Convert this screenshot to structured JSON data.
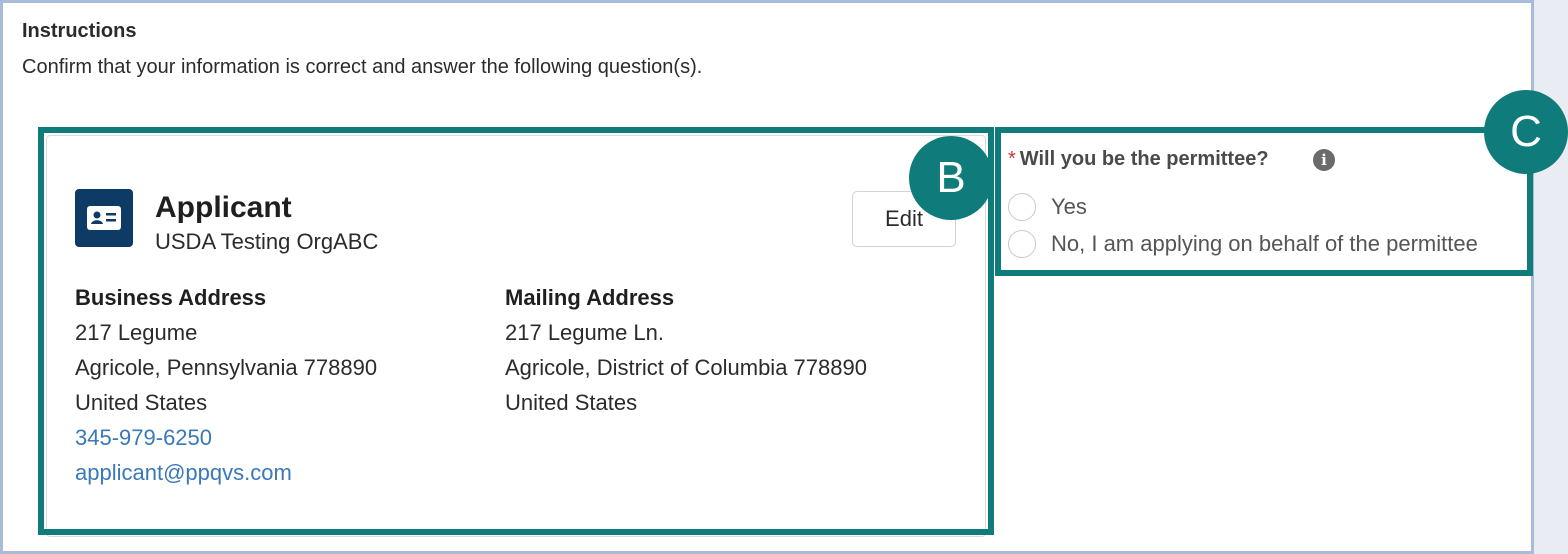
{
  "instructions": {
    "title": "Instructions",
    "text": "Confirm that your information is correct and answer the following question(s)."
  },
  "applicant_card": {
    "icon": "contact-card-icon",
    "title": "Applicant",
    "subtitle": "USDA Testing OrgABC",
    "edit_label": "Edit",
    "business_address": {
      "heading": "Business Address",
      "line1": "217 Legume",
      "line2": "Agricole, Pennsylvania 778890",
      "country": "United States",
      "phone": "345-979-6250",
      "email": "applicant@ppqvs.com"
    },
    "mailing_address": {
      "heading": "Mailing Address",
      "line1": "217 Legume Ln.",
      "line2": "Agricole, District of Columbia 778890",
      "country": "United States"
    }
  },
  "question": {
    "required_marker": "*",
    "label": "Will you be the permittee?",
    "info_icon": "info-icon",
    "options": [
      "Yes",
      "No, I am applying on behalf of the permittee"
    ]
  },
  "callouts": {
    "b": "B",
    "c": "C"
  },
  "colors": {
    "highlight": "#0f7b7b",
    "icon_bg": "#0e3a66",
    "link": "#3a78b8",
    "required": "#c23934"
  }
}
